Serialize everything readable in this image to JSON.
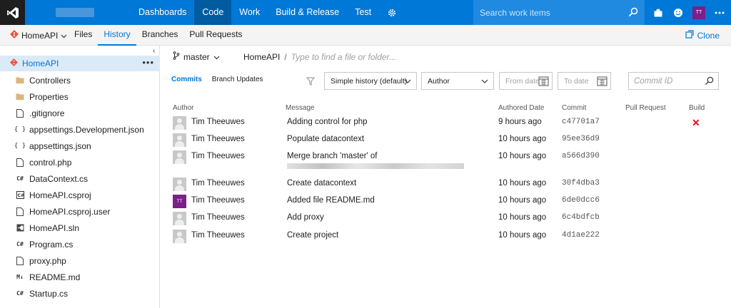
{
  "topbar": {
    "nav": [
      "Dashboards",
      "Code",
      "Work",
      "Build & Release",
      "Test"
    ],
    "active_nav": "Code",
    "search_placeholder": "Search work items",
    "user_initials": "TT",
    "brand_color": "#0078d7"
  },
  "subbar": {
    "repo": "HomeAPI",
    "tabs": [
      "Files",
      "History",
      "Branches",
      "Pull Requests"
    ],
    "active_tab": "History",
    "clone_label": "Clone"
  },
  "sidebar": {
    "root": "HomeAPI",
    "items": [
      {
        "name": "Controllers",
        "type": "folder"
      },
      {
        "name": "Properties",
        "type": "folder"
      },
      {
        "name": ".gitignore",
        "type": "file"
      },
      {
        "name": "appsettings.Development.json",
        "type": "json"
      },
      {
        "name": "appsettings.json",
        "type": "json"
      },
      {
        "name": "control.php",
        "type": "file"
      },
      {
        "name": "DataContext.cs",
        "type": "cs"
      },
      {
        "name": "HomeAPI.csproj",
        "type": "csproj"
      },
      {
        "name": "HomeAPI.csproj.user",
        "type": "file"
      },
      {
        "name": "HomeAPI.sln",
        "type": "sln"
      },
      {
        "name": "Program.cs",
        "type": "cs"
      },
      {
        "name": "proxy.php",
        "type": "file"
      },
      {
        "name": "README.md",
        "type": "md"
      },
      {
        "name": "Startup.cs",
        "type": "cs"
      }
    ]
  },
  "main": {
    "branch": "master",
    "path_root": "HomeAPI",
    "path_placeholder": "Type to find a file or folder...",
    "view_tabs": [
      "Commits",
      "Branch Updates"
    ],
    "history_mode": "Simple history (default)",
    "author_filter": "Author",
    "from_date_placeholder": "From date",
    "to_date_placeholder": "To date",
    "commit_id_placeholder": "Commit ID",
    "columns": [
      "Author",
      "Message",
      "Authored Date",
      "Commit",
      "Pull Request",
      "Build"
    ],
    "commits": [
      {
        "author": "Tim Theeuwes",
        "message": "Adding control for php",
        "date": "9 hours ago",
        "commit": "c47701a7",
        "build": "failed"
      },
      {
        "author": "Tim Theeuwes",
        "message": "Populate datacontext",
        "date": "10 hours ago",
        "commit": "95ee36d9",
        "build": ""
      },
      {
        "author": "Tim Theeuwes",
        "message": "Merge branch 'master' of",
        "date": "10 hours ago",
        "commit": "a566d390",
        "build": ""
      },
      {
        "author": "Tim Theeuwes",
        "message": "Create datacontext",
        "date": "10 hours ago",
        "commit": "30f4dba3",
        "build": ""
      },
      {
        "author": "Tim Theeuwes",
        "message": "Added file README.md",
        "date": "10 hours ago",
        "commit": "6de0dcc6",
        "build": "",
        "avatar_initials": "TT"
      },
      {
        "author": "Tim Theeuwes",
        "message": "Add proxy",
        "date": "10 hours ago",
        "commit": "6c4bdfcb",
        "build": ""
      },
      {
        "author": "Tim Theeuwes",
        "message": "Create project",
        "date": "10 hours ago",
        "commit": "4d1ae222",
        "build": ""
      }
    ]
  }
}
